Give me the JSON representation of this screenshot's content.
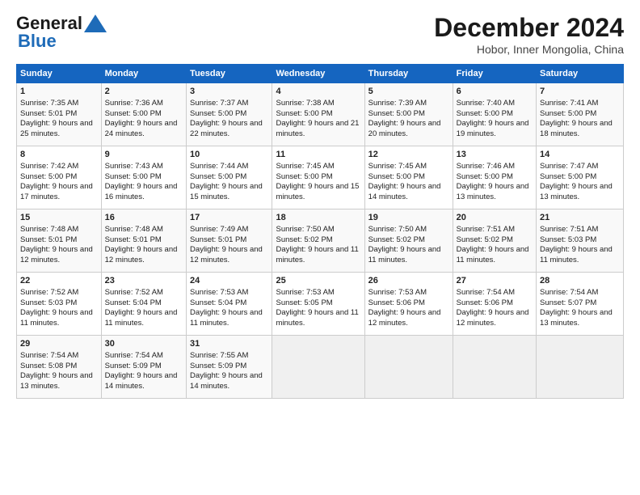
{
  "logo": {
    "line1": "General",
    "line2": "Blue"
  },
  "title": "December 2024",
  "subtitle": "Hobor, Inner Mongolia, China",
  "days": [
    "Sunday",
    "Monday",
    "Tuesday",
    "Wednesday",
    "Thursday",
    "Friday",
    "Saturday"
  ],
  "weeks": [
    [
      {
        "day": "1",
        "sunrise": "Sunrise: 7:35 AM",
        "sunset": "Sunset: 5:01 PM",
        "daylight": "Daylight: 9 hours and 25 minutes."
      },
      {
        "day": "2",
        "sunrise": "Sunrise: 7:36 AM",
        "sunset": "Sunset: 5:00 PM",
        "daylight": "Daylight: 9 hours and 24 minutes."
      },
      {
        "day": "3",
        "sunrise": "Sunrise: 7:37 AM",
        "sunset": "Sunset: 5:00 PM",
        "daylight": "Daylight: 9 hours and 22 minutes."
      },
      {
        "day": "4",
        "sunrise": "Sunrise: 7:38 AM",
        "sunset": "Sunset: 5:00 PM",
        "daylight": "Daylight: 9 hours and 21 minutes."
      },
      {
        "day": "5",
        "sunrise": "Sunrise: 7:39 AM",
        "sunset": "Sunset: 5:00 PM",
        "daylight": "Daylight: 9 hours and 20 minutes."
      },
      {
        "day": "6",
        "sunrise": "Sunrise: 7:40 AM",
        "sunset": "Sunset: 5:00 PM",
        "daylight": "Daylight: 9 hours and 19 minutes."
      },
      {
        "day": "7",
        "sunrise": "Sunrise: 7:41 AM",
        "sunset": "Sunset: 5:00 PM",
        "daylight": "Daylight: 9 hours and 18 minutes."
      }
    ],
    [
      {
        "day": "8",
        "sunrise": "Sunrise: 7:42 AM",
        "sunset": "Sunset: 5:00 PM",
        "daylight": "Daylight: 9 hours and 17 minutes."
      },
      {
        "day": "9",
        "sunrise": "Sunrise: 7:43 AM",
        "sunset": "Sunset: 5:00 PM",
        "daylight": "Daylight: 9 hours and 16 minutes."
      },
      {
        "day": "10",
        "sunrise": "Sunrise: 7:44 AM",
        "sunset": "Sunset: 5:00 PM",
        "daylight": "Daylight: 9 hours and 15 minutes."
      },
      {
        "day": "11",
        "sunrise": "Sunrise: 7:45 AM",
        "sunset": "Sunset: 5:00 PM",
        "daylight": "Daylight: 9 hours and 15 minutes."
      },
      {
        "day": "12",
        "sunrise": "Sunrise: 7:45 AM",
        "sunset": "Sunset: 5:00 PM",
        "daylight": "Daylight: 9 hours and 14 minutes."
      },
      {
        "day": "13",
        "sunrise": "Sunrise: 7:46 AM",
        "sunset": "Sunset: 5:00 PM",
        "daylight": "Daylight: 9 hours and 13 minutes."
      },
      {
        "day": "14",
        "sunrise": "Sunrise: 7:47 AM",
        "sunset": "Sunset: 5:00 PM",
        "daylight": "Daylight: 9 hours and 13 minutes."
      }
    ],
    [
      {
        "day": "15",
        "sunrise": "Sunrise: 7:48 AM",
        "sunset": "Sunset: 5:01 PM",
        "daylight": "Daylight: 9 hours and 12 minutes."
      },
      {
        "day": "16",
        "sunrise": "Sunrise: 7:48 AM",
        "sunset": "Sunset: 5:01 PM",
        "daylight": "Daylight: 9 hours and 12 minutes."
      },
      {
        "day": "17",
        "sunrise": "Sunrise: 7:49 AM",
        "sunset": "Sunset: 5:01 PM",
        "daylight": "Daylight: 9 hours and 12 minutes."
      },
      {
        "day": "18",
        "sunrise": "Sunrise: 7:50 AM",
        "sunset": "Sunset: 5:02 PM",
        "daylight": "Daylight: 9 hours and 11 minutes."
      },
      {
        "day": "19",
        "sunrise": "Sunrise: 7:50 AM",
        "sunset": "Sunset: 5:02 PM",
        "daylight": "Daylight: 9 hours and 11 minutes."
      },
      {
        "day": "20",
        "sunrise": "Sunrise: 7:51 AM",
        "sunset": "Sunset: 5:02 PM",
        "daylight": "Daylight: 9 hours and 11 minutes."
      },
      {
        "day": "21",
        "sunrise": "Sunrise: 7:51 AM",
        "sunset": "Sunset: 5:03 PM",
        "daylight": "Daylight: 9 hours and 11 minutes."
      }
    ],
    [
      {
        "day": "22",
        "sunrise": "Sunrise: 7:52 AM",
        "sunset": "Sunset: 5:03 PM",
        "daylight": "Daylight: 9 hours and 11 minutes."
      },
      {
        "day": "23",
        "sunrise": "Sunrise: 7:52 AM",
        "sunset": "Sunset: 5:04 PM",
        "daylight": "Daylight: 9 hours and 11 minutes."
      },
      {
        "day": "24",
        "sunrise": "Sunrise: 7:53 AM",
        "sunset": "Sunset: 5:04 PM",
        "daylight": "Daylight: 9 hours and 11 minutes."
      },
      {
        "day": "25",
        "sunrise": "Sunrise: 7:53 AM",
        "sunset": "Sunset: 5:05 PM",
        "daylight": "Daylight: 9 hours and 11 minutes."
      },
      {
        "day": "26",
        "sunrise": "Sunrise: 7:53 AM",
        "sunset": "Sunset: 5:06 PM",
        "daylight": "Daylight: 9 hours and 12 minutes."
      },
      {
        "day": "27",
        "sunrise": "Sunrise: 7:54 AM",
        "sunset": "Sunset: 5:06 PM",
        "daylight": "Daylight: 9 hours and 12 minutes."
      },
      {
        "day": "28",
        "sunrise": "Sunrise: 7:54 AM",
        "sunset": "Sunset: 5:07 PM",
        "daylight": "Daylight: 9 hours and 13 minutes."
      }
    ],
    [
      {
        "day": "29",
        "sunrise": "Sunrise: 7:54 AM",
        "sunset": "Sunset: 5:08 PM",
        "daylight": "Daylight: 9 hours and 13 minutes."
      },
      {
        "day": "30",
        "sunrise": "Sunrise: 7:54 AM",
        "sunset": "Sunset: 5:09 PM",
        "daylight": "Daylight: 9 hours and 14 minutes."
      },
      {
        "day": "31",
        "sunrise": "Sunrise: 7:55 AM",
        "sunset": "Sunset: 5:09 PM",
        "daylight": "Daylight: 9 hours and 14 minutes."
      },
      null,
      null,
      null,
      null
    ]
  ]
}
